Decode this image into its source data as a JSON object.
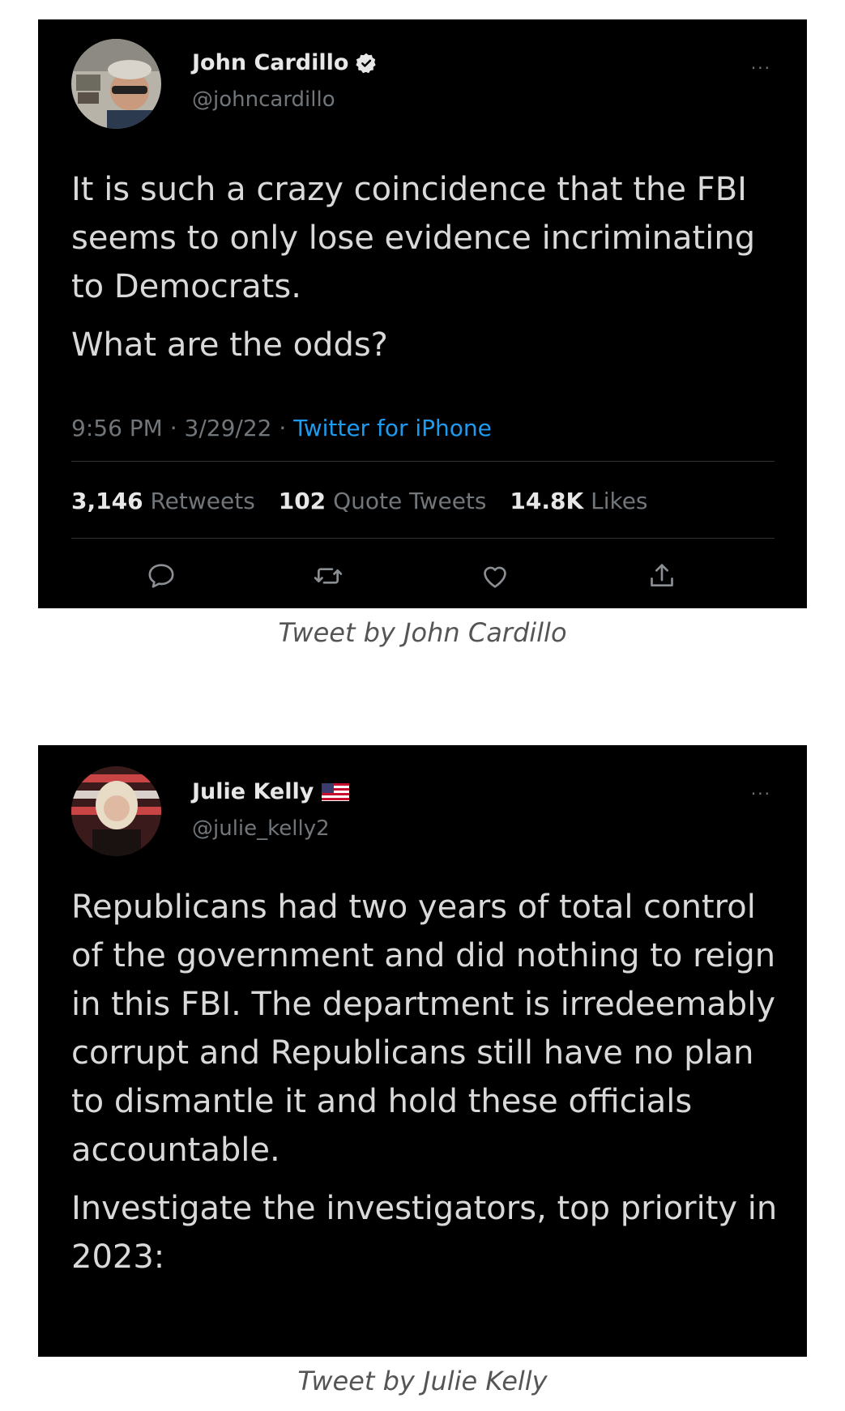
{
  "tweets": [
    {
      "author": {
        "name": "John Cardillo",
        "handle": "@johncardillo",
        "verified": true
      },
      "text": [
        "It is such a crazy coincidence that the FBI seems to only lose evidence incriminating to Democrats.",
        "What are the odds?"
      ],
      "meta": {
        "time": "9:56 PM",
        "separator": "·",
        "date": "3/29/22",
        "source": "Twitter for iPhone"
      },
      "stats": {
        "retweets_count": "3,146",
        "retweets_label": "Retweets",
        "quotes_count": "102",
        "quotes_label": "Quote Tweets",
        "likes_count": "14.8K",
        "likes_label": "Likes"
      },
      "actions": [
        "reply-icon",
        "retweet-icon",
        "like-icon",
        "share-icon"
      ],
      "more_icon": "···",
      "caption": "Tweet by John Cardillo"
    },
    {
      "author": {
        "name": "Julie Kelly",
        "handle": "@julie_kelly2",
        "flag": "us-flag-icon"
      },
      "text": [
        "Republicans had two years of total control of the government and did nothing to reign in this FBI. The department is irredeemably corrupt and Republicans still have no plan to dismantle it and hold these officials accountable.",
        "Investigate the investigators, top priority in 2023:"
      ],
      "more_icon": "···",
      "caption": "Tweet by Julie Kelly"
    }
  ],
  "colors": {
    "card_background": "#000000",
    "text": "#d9d9d9",
    "muted": "#71767b",
    "link": "#1d9bf0",
    "caption": "#555555"
  }
}
